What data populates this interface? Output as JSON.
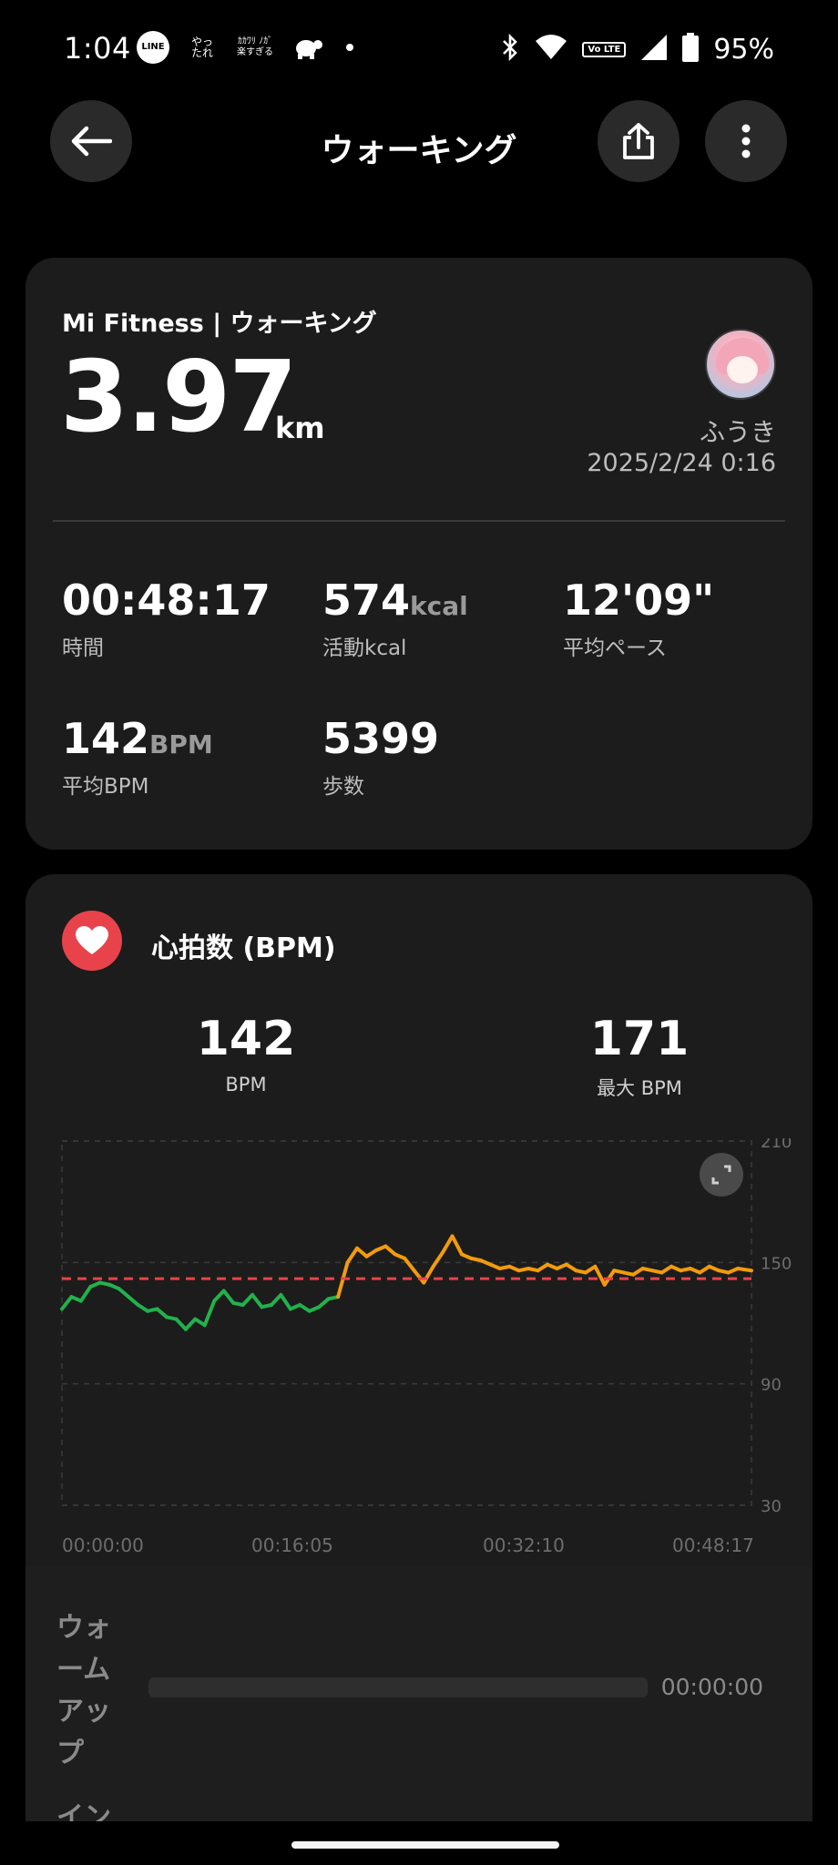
{
  "status_bar": {
    "time": "1:04",
    "apps": [
      "LINE",
      "やっ たれ",
      "ｶｶﾜﾘ ﾉｶﾞ 楽すぎる"
    ],
    "volte": "Vo LTE",
    "battery": "95%"
  },
  "header": {
    "title": "ウォーキング"
  },
  "summary": {
    "source": "Mi Fitness | ウォーキング",
    "distance": "3.97",
    "distance_unit": "km",
    "user_name": "ふうき",
    "datetime": "2025/2/24 0:16",
    "stats": [
      {
        "value": "00:48:17",
        "unit": "",
        "label": "時間"
      },
      {
        "value": "574",
        "unit": "kcal",
        "label": "活動kcal"
      },
      {
        "value": "12'09\"",
        "unit": "",
        "label": "平均ペース"
      },
      {
        "value": "142",
        "unit": "BPM",
        "label": "平均BPM"
      },
      {
        "value": "5399",
        "unit": "",
        "label": "歩数"
      }
    ]
  },
  "heart": {
    "title": "心拍数 (BPM)",
    "avg_value": "142",
    "avg_label": "BPM",
    "max_value": "171",
    "max_label": "最大 BPM",
    "zone_label": "ウォ ーム アッ プ",
    "zone_time": "00:00:00",
    "next_zone_label": "イン"
  },
  "colors": {
    "background": "#000000",
    "card": "#1c1c1c",
    "heart": "#e8434b",
    "low_zone": "#22b14c",
    "high_zone": "#f29b0c",
    "avg_line": "#e8434b"
  },
  "chart_data": {
    "type": "line",
    "title": "",
    "xlabel": "",
    "ylabel": "",
    "x_ticks": [
      "00:00:00",
      "00:16:05",
      "00:32:10",
      "00:48:17"
    ],
    "y_ticks": [
      210,
      150,
      90,
      30
    ],
    "ylim": [
      30,
      210
    ],
    "xlim_seconds": [
      0,
      2897
    ],
    "average": 142,
    "x_seconds": [
      0,
      40,
      80,
      120,
      160,
      200,
      240,
      280,
      320,
      360,
      400,
      440,
      480,
      520,
      560,
      600,
      640,
      680,
      720,
      760,
      800,
      840,
      880,
      920,
      960,
      1000,
      1040,
      1080,
      1120,
      1160,
      1200,
      1240,
      1280,
      1320,
      1360,
      1400,
      1440,
      1480,
      1520,
      1560,
      1600,
      1640,
      1680,
      1720,
      1760,
      1800,
      1840,
      1880,
      1920,
      1960,
      2000,
      2040,
      2080,
      2120,
      2160,
      2200,
      2240,
      2280,
      2320,
      2360,
      2400,
      2440,
      2480,
      2520,
      2560,
      2600,
      2640,
      2680,
      2720,
      2760,
      2800,
      2840,
      2897
    ],
    "bpm": [
      127,
      133,
      131,
      138,
      140,
      139,
      137,
      133,
      129,
      126,
      127,
      123,
      122,
      117,
      122,
      119,
      131,
      136,
      130,
      129,
      134,
      128,
      129,
      134,
      127,
      129,
      126,
      128,
      132,
      133,
      150,
      157,
      153,
      156,
      158,
      154,
      152,
      146,
      140,
      148,
      155,
      163,
      154,
      152,
      151,
      149,
      147,
      148,
      146,
      147,
      146,
      149,
      147,
      149,
      146,
      145,
      148,
      139,
      146,
      145,
      144,
      147,
      146,
      145,
      148,
      146,
      147,
      145,
      148,
      146,
      145,
      147,
      146
    ],
    "zone_threshold": 140
  }
}
